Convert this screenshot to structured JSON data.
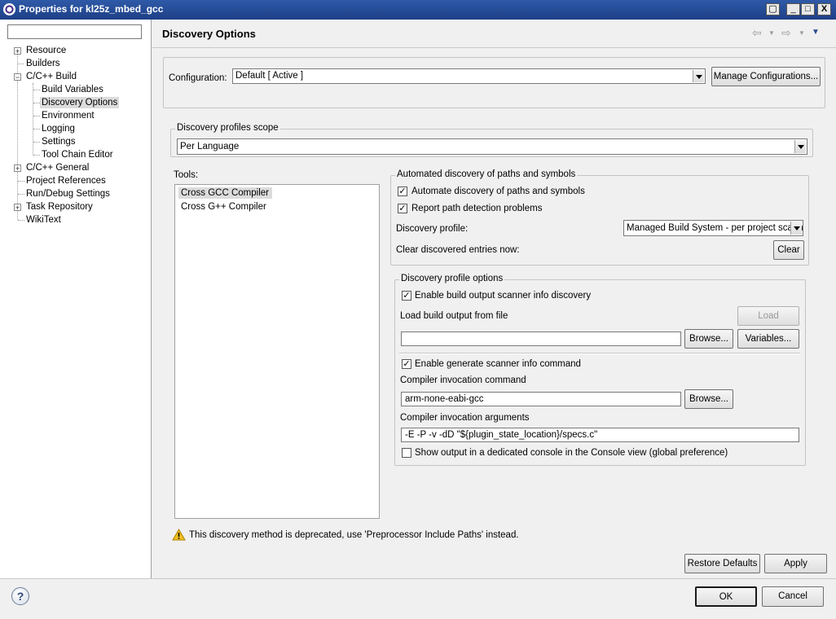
{
  "window": {
    "title": "Properties for kl25z_mbed_gcc",
    "controls": {
      "restore": "▢",
      "minimize": "_",
      "maximize": "□",
      "close": "X"
    }
  },
  "tree": {
    "filter_value": "",
    "items": [
      {
        "label": "Resource",
        "expander": "+"
      },
      {
        "label": "Builders"
      },
      {
        "label": "C/C++ Build",
        "expander": "−"
      },
      {
        "label": "Build Variables"
      },
      {
        "label": "Discovery Options",
        "selected": true
      },
      {
        "label": "Environment"
      },
      {
        "label": "Logging"
      },
      {
        "label": "Settings"
      },
      {
        "label": "Tool Chain Editor"
      },
      {
        "label": "C/C++ General",
        "expander": "+"
      },
      {
        "label": "Project References"
      },
      {
        "label": "Run/Debug Settings"
      },
      {
        "label": "Task Repository",
        "expander": "+"
      },
      {
        "label": "WikiText"
      }
    ]
  },
  "header": {
    "title": "Discovery Options",
    "icons": [
      "back-arrow-icon",
      "forward-arrow-icon",
      "view-menu-icon"
    ]
  },
  "configuration": {
    "label": "Configuration:",
    "value": "Default  [ Active ]",
    "manage_label": "Manage Configurations..."
  },
  "scope": {
    "legend": "Discovery profiles scope",
    "value": "Per Language"
  },
  "tools": {
    "label": "Tools:",
    "items": [
      "Cross GCC Compiler",
      "Cross G++ Compiler"
    ],
    "selected_index": 0
  },
  "auto": {
    "legend": "Automated discovery of paths and symbols",
    "automate_label": "Automate discovery of paths and symbols",
    "automate_checked": true,
    "report_label": "Report path detection problems",
    "report_checked": true,
    "profile_label": "Discovery profile:",
    "profile_value": "Managed Build System - per project scanner info profile",
    "clear_label": "Clear discovered entries now:",
    "clear_button": "Clear"
  },
  "profile_options": {
    "legend": "Discovery profile options",
    "enable_output_label": "Enable build output scanner info discovery",
    "enable_output_checked": true,
    "load_label": "Load build output from file",
    "load_button": "Load",
    "file_value": "",
    "browse_label": "Browse...",
    "variables_label": "Variables...",
    "enable_generate_label": "Enable generate scanner info command",
    "enable_generate_checked": true,
    "cmd_label": "Compiler invocation command",
    "cmd_value": "arm-none-eabi-gcc",
    "cmd_browse_label": "Browse...",
    "args_label": "Compiler invocation arguments",
    "args_value": "-E -P -v -dD \"${plugin_state_location}/specs.c\"",
    "console_label": "Show output in a dedicated console in the Console view (global preference)",
    "console_checked": false
  },
  "warning": {
    "text": "This discovery method is deprecated, use 'Preprocessor Include Paths' instead."
  },
  "buttons": {
    "restore_defaults": "Restore Defaults",
    "apply": "Apply",
    "ok": "OK",
    "cancel": "Cancel",
    "help": "?"
  },
  "colors": {
    "titlebar": "#1d3f86",
    "selection": "#dcdcdc",
    "warning": "#f0c020"
  }
}
